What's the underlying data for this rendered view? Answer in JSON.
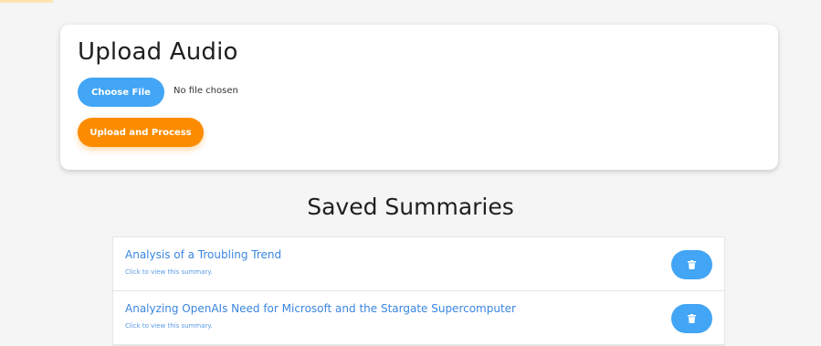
{
  "upload": {
    "title": "Upload Audio",
    "choose_file_label": "Choose File",
    "file_status": "No file chosen",
    "process_label": "Upload and Process"
  },
  "summaries": {
    "heading": "Saved Summaries",
    "items": [
      {
        "title": "Analysis of a Troubling Trend",
        "subtitle": "Click to view this summary.",
        "delete_icon": "trash-icon"
      },
      {
        "title": "Analyzing OpenAIs Need for Microsoft and the Stargate Supercomputer",
        "subtitle": "Click to view this summary.",
        "delete_icon": "trash-icon"
      }
    ]
  },
  "colors": {
    "background": "#f5f5f5",
    "primary_button": "#42a5f5",
    "accent_button": "#fb8c00",
    "link_text": "#3a86e0"
  }
}
